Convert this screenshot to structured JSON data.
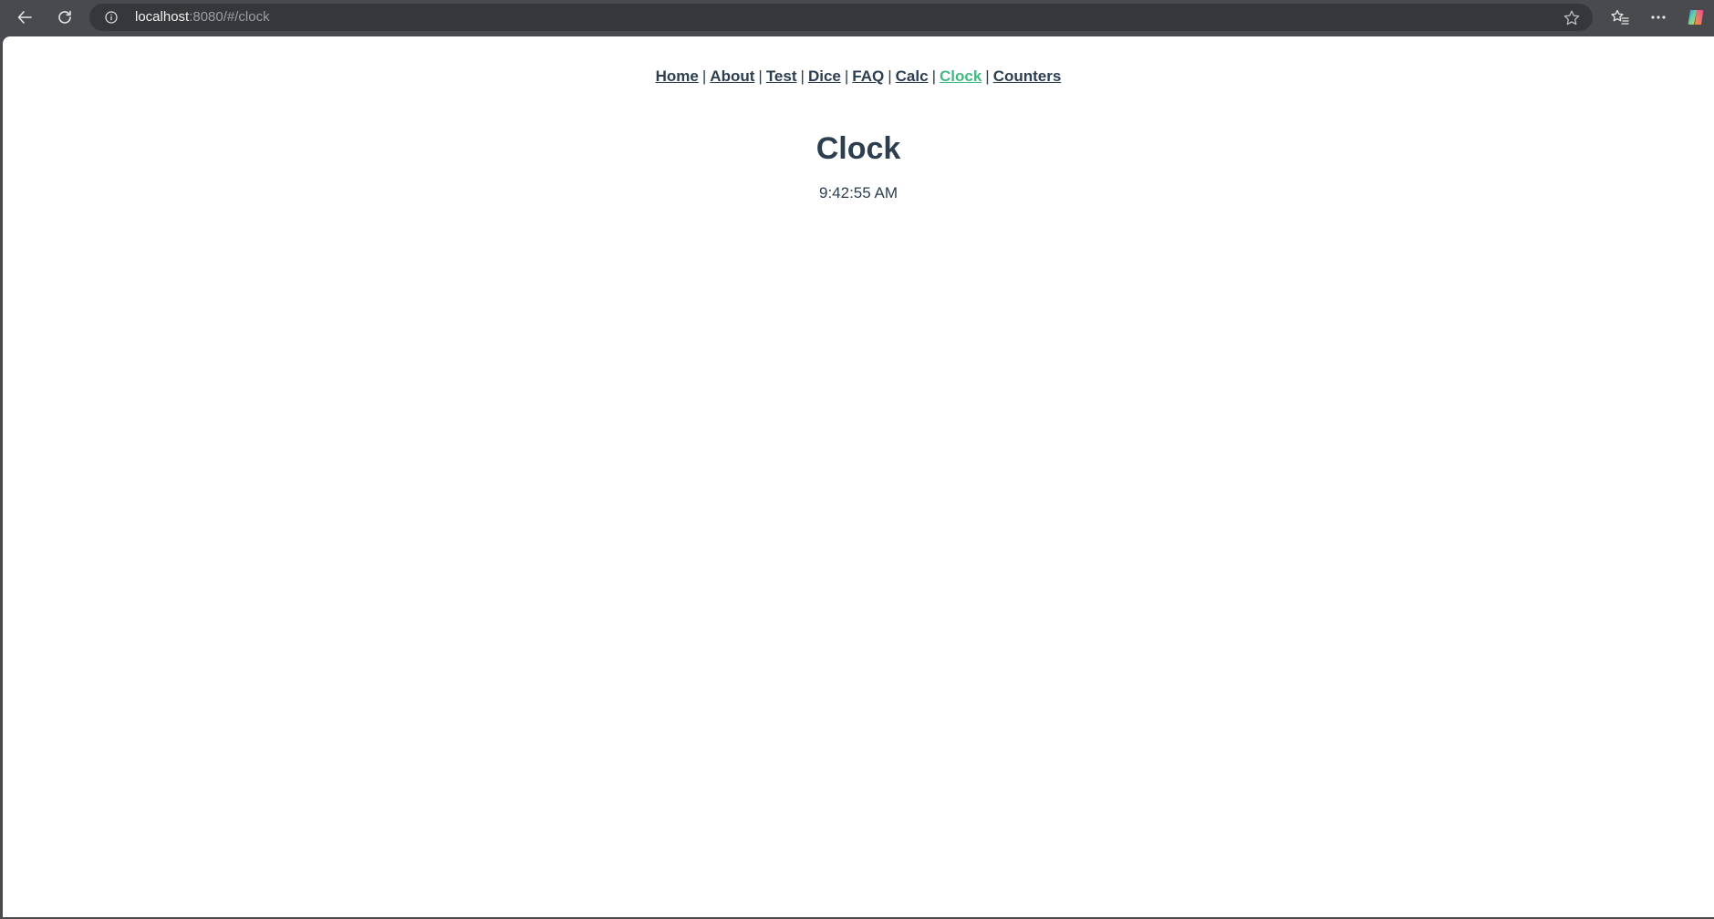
{
  "browser": {
    "url_host": "localhost",
    "url_rest": ":8080/#/clock",
    "icons": [
      "back-arrow-icon",
      "refresh-icon",
      "info-icon",
      "star-icon",
      "favorites-icon",
      "more-icon",
      "copilot-icon"
    ]
  },
  "nav": {
    "items": [
      {
        "label": "Home"
      },
      {
        "label": "About"
      },
      {
        "label": "Test"
      },
      {
        "label": "Dice"
      },
      {
        "label": "FAQ"
      },
      {
        "label": "Calc"
      },
      {
        "label": "Clock",
        "active": true
      },
      {
        "label": "Counters"
      }
    ],
    "separator": "|"
  },
  "page": {
    "title": "Clock",
    "time": "9:42:55 AM"
  },
  "colors": {
    "text": "#2c3e50",
    "active_link": "#42b983",
    "toolbar": "#494a4e",
    "addressbar": "#36373a"
  }
}
